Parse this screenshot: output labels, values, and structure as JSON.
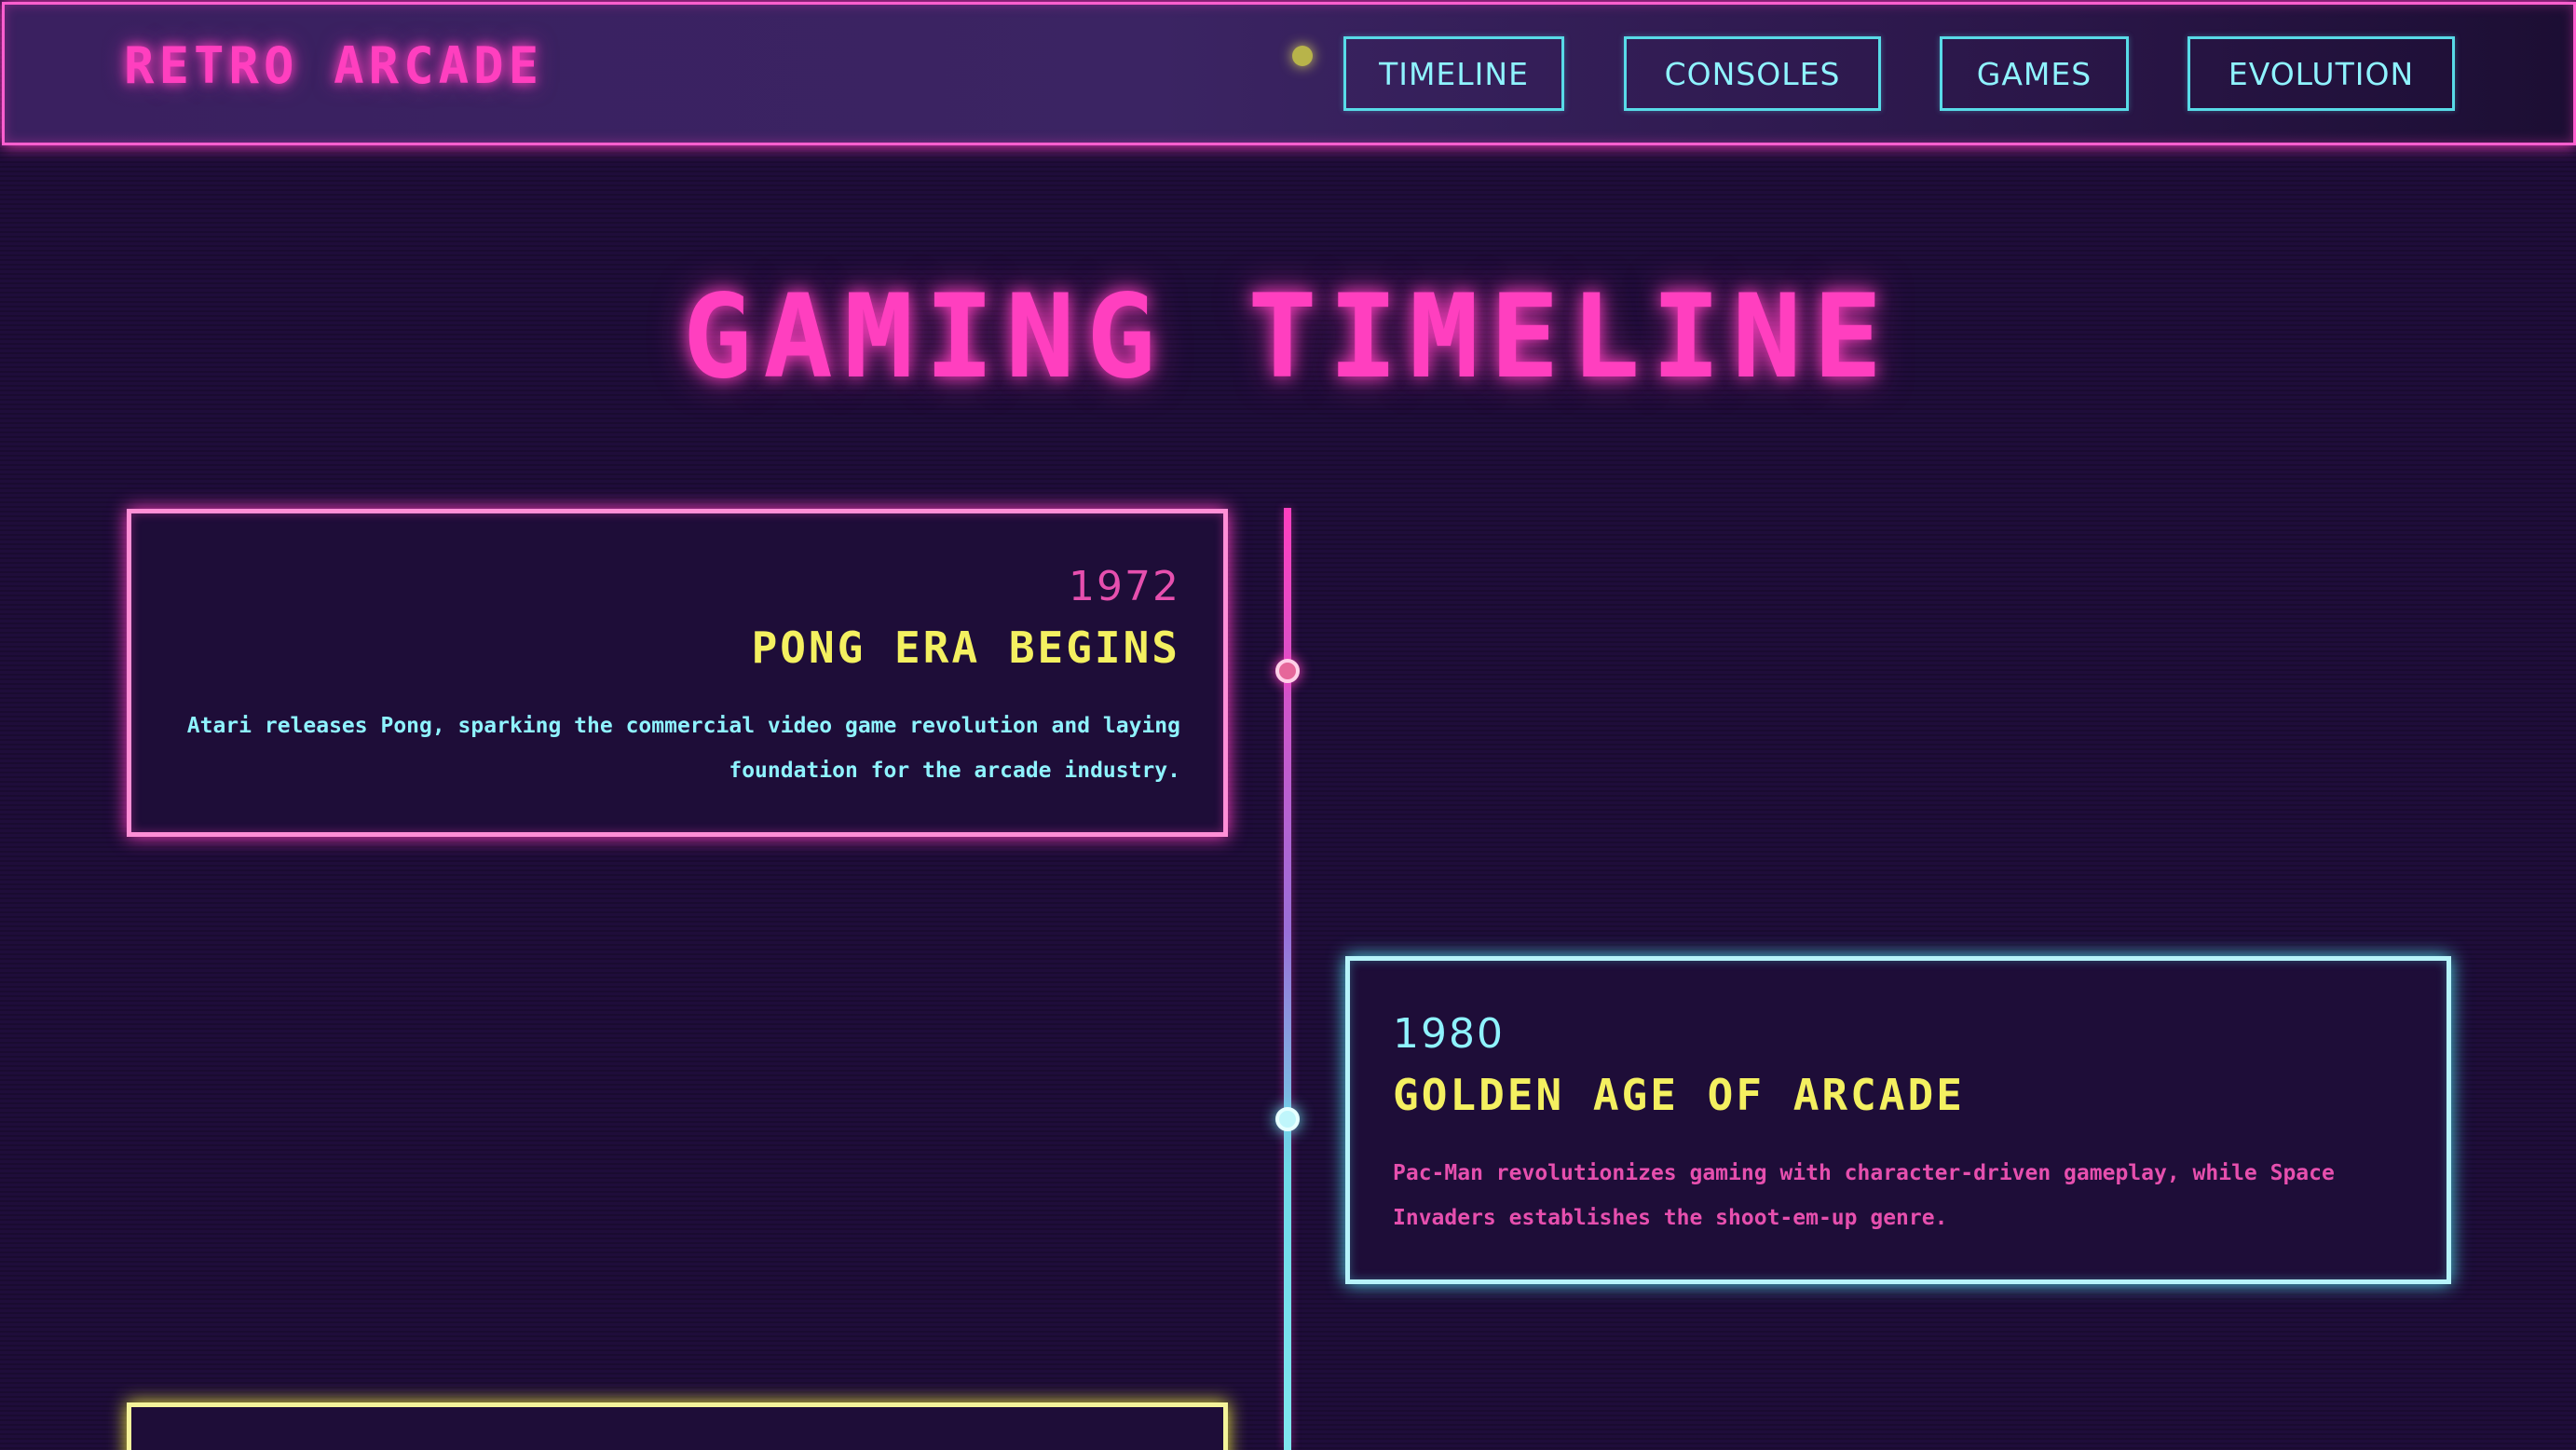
{
  "header": {
    "brand": "RETRO ARCADE",
    "nav": [
      "TIMELINE",
      "CONSOLES",
      "GAMES",
      "EVOLUTION"
    ]
  },
  "page_title": "GAMING TIMELINE",
  "timeline": [
    {
      "year": "1972",
      "title": "PONG ERA BEGINS",
      "description": "Atari releases Pong, sparking the commercial video game revolution and laying foundation for the arcade industry."
    },
    {
      "year": "1980",
      "title": "GOLDEN AGE OF ARCADE",
      "description": "Pac-Man revolutionizes gaming with character-driven gameplay, while Space Invaders establishes the shoot-em-up genre."
    }
  ],
  "colors": {
    "neon_pink": "#ff3fbf",
    "neon_cyan": "#8ff3ff",
    "neon_yellow": "#f4f060",
    "background": "#1f0d3a"
  }
}
